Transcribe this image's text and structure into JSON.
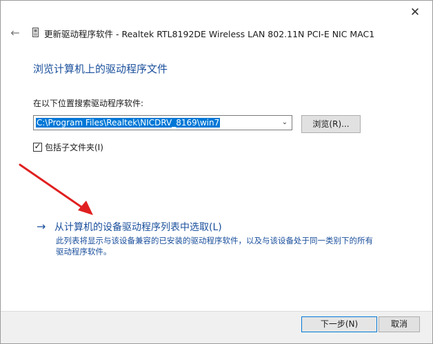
{
  "window": {
    "title": "更新驱动程序软件 - Realtek RTL8192DE Wireless LAN 802.11N PCI-E NIC MAC1",
    "close_glyph": "✕",
    "back_glyph": "←",
    "icons": [
      "close-icon",
      "back-arrow-icon",
      "device-icon"
    ]
  },
  "main": {
    "heading": "浏览计算机上的驱动程序文件",
    "search_label": "在以下位置搜索驱动程序软件:",
    "path_value": "C:\\Program Files\\Realtek\\NICDRV_8169\\win7",
    "dropdown_glyph": "⌄",
    "browse_label": "浏览(R)...",
    "include_subfolders": {
      "label": "包括子文件夹(I)",
      "checked": true,
      "check_glyph": "✓"
    },
    "pick_option": {
      "arrow_glyph": "→",
      "title": "从计算机的设备驱动程序列表中选取(L)",
      "description": "此列表将显示与该设备兼容的已安装的驱动程序软件，以及与该设备处于同一类别下的所有驱动程序软件。"
    }
  },
  "footer": {
    "next_label": "下一步(N)",
    "cancel_label": "取消"
  },
  "colors": {
    "accent_blue": "#1a4f9c",
    "selection_blue": "#0078d7",
    "annotation_red": "#e02020"
  }
}
